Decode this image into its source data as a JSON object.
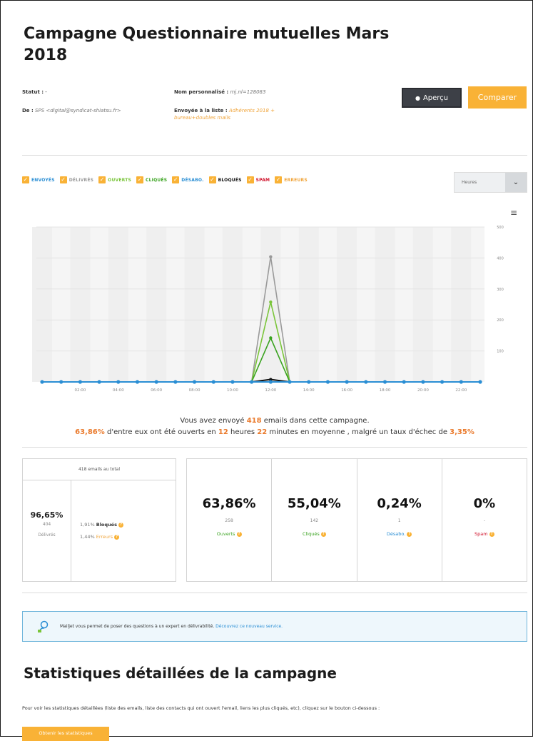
{
  "header": {
    "title": "Campagne Questionnaire mutuelles Mars 2018",
    "statut_label": "Statut :",
    "statut_value": "-",
    "de_label": "De :",
    "de_value": "SPS <digital@syndicat-shiatsu.fr>",
    "nom_label": "Nom personnalisé :",
    "nom_value": "mj.nl=128083",
    "liste_label": "Envoyée à la liste :",
    "liste_value": "Adhérents 2018 + bureau+doubles mails",
    "apercu_label": "Aperçu",
    "comparer_label": "Comparer"
  },
  "legend": [
    {
      "label": "ENVOYÉS",
      "color": "#2a8ed4"
    },
    {
      "label": "DÉLIVRÉS",
      "color": "#9a9a9a"
    },
    {
      "label": "OUVERTS",
      "color": "#7ac53a"
    },
    {
      "label": "CLIQUÉS",
      "color": "#3aa320"
    },
    {
      "label": "DÉSABO.",
      "color": "#2a8ed4"
    },
    {
      "label": "BLOQUÉS",
      "color": "#111111"
    },
    {
      "label": "SPAM",
      "color": "#d0122b"
    },
    {
      "label": "ERREURS",
      "color": "#f0a43a"
    }
  ],
  "granularity": {
    "selected": "Heures"
  },
  "chart_data": {
    "type": "line",
    "x": [
      "00:00",
      "01:00",
      "02:00",
      "03:00",
      "04:00",
      "05:00",
      "06:00",
      "07:00",
      "08:00",
      "09:00",
      "10:00",
      "11:00",
      "12:00",
      "13:00",
      "14:00",
      "15:00",
      "16:00",
      "17:00",
      "18:00",
      "19:00",
      "20:00",
      "21:00",
      "22:00",
      "23:00"
    ],
    "x_tick_labels": [
      "02:00",
      "04:00",
      "06:00",
      "08:00",
      "10:00",
      "12:00",
      "14:00",
      "16:00",
      "18:00",
      "20:00",
      "22:00"
    ],
    "ylim": [
      0,
      500
    ],
    "y_tick_labels": [
      "100",
      "200",
      "300",
      "400",
      "500"
    ],
    "series": [
      {
        "name": "ENVOYÉS",
        "color": "#2a8ed4",
        "values": [
          0,
          0,
          0,
          0,
          0,
          0,
          0,
          0,
          0,
          0,
          0,
          0,
          0,
          0,
          0,
          0,
          0,
          0,
          0,
          0,
          0,
          0,
          0,
          0
        ]
      },
      {
        "name": "DÉLIVRÉS",
        "color": "#9a9a9a",
        "values": [
          0,
          0,
          0,
          0,
          0,
          0,
          0,
          0,
          0,
          0,
          0,
          0,
          404,
          0,
          0,
          0,
          0,
          0,
          0,
          0,
          0,
          0,
          0,
          0
        ]
      },
      {
        "name": "OUVERTS",
        "color": "#7ac53a",
        "values": [
          0,
          0,
          0,
          0,
          0,
          0,
          0,
          0,
          0,
          0,
          0,
          0,
          258,
          0,
          0,
          0,
          0,
          0,
          0,
          0,
          0,
          0,
          0,
          0
        ]
      },
      {
        "name": "CLIQUÉS",
        "color": "#3aa320",
        "values": [
          0,
          0,
          0,
          0,
          0,
          0,
          0,
          0,
          0,
          0,
          0,
          0,
          142,
          0,
          0,
          0,
          0,
          0,
          0,
          0,
          0,
          0,
          0,
          0
        ]
      },
      {
        "name": "BLOQUÉS",
        "color": "#111111",
        "values": [
          0,
          0,
          0,
          0,
          0,
          0,
          0,
          0,
          0,
          0,
          0,
          0,
          8,
          0,
          0,
          0,
          0,
          0,
          0,
          0,
          0,
          0,
          0,
          0
        ]
      }
    ]
  },
  "summary": {
    "line1_a": "Vous avez envoyé",
    "sent": "418",
    "line1_b": "emails dans cette campagne.",
    "open_rate": "63,86%",
    "line2_a": "d'entre eux ont été ouverts en",
    "hours": "12",
    "line2_b": "heures",
    "minutes": "22",
    "line2_c": "minutes en moyenne , malgré un taux d'échec de",
    "fail_rate": "3,35%"
  },
  "totals": {
    "header": "418 emails au total",
    "delivered_pct": "96,65%",
    "delivered_count": "404",
    "delivered_label": "Délivrés",
    "blocked_pct": "1,91%",
    "blocked_label": "Bloqués",
    "errors_pct": "1,44%",
    "errors_label": "Erreurs"
  },
  "stats": [
    {
      "pct": "63,86%",
      "count": "258",
      "label": "Ouverts",
      "color": "#3aa320"
    },
    {
      "pct": "55,04%",
      "count": "142",
      "label": "Cliqués",
      "color": "#3aa320"
    },
    {
      "pct": "0,24%",
      "count": "1",
      "label": "Désabo.",
      "color": "#2a8ed4"
    },
    {
      "pct": "0%",
      "count": "-",
      "label": "Spam",
      "color": "#d0122b"
    }
  ],
  "banner": {
    "text": "Mailjet vous permet de poser des questions à un expert en délivrabilité.",
    "link": "Découvrez ce nouveau service."
  },
  "details": {
    "title": "Statistiques détaillées de la campagne",
    "text": "Pour voir les statistiques détaillées (liste des emails, liste des contacts qui ont ouvert l'email, liens les plus cliqués, etc), cliquez sur le bouton ci-dessous :",
    "button": "Obtenir les statistiques"
  }
}
